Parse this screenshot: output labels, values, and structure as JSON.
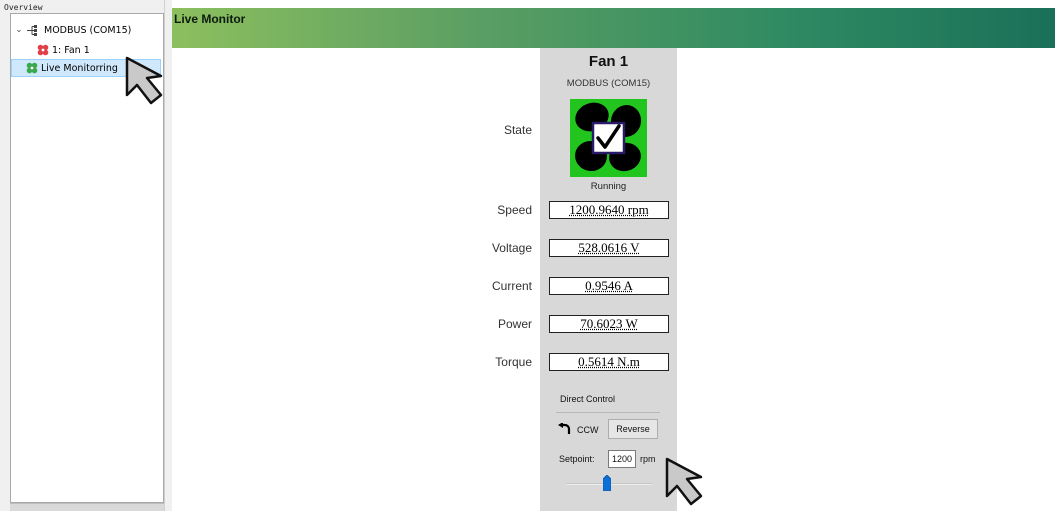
{
  "overview": {
    "header": "Overview",
    "tree": [
      {
        "label": "MODBUS (COM15)",
        "icon": "network-icon",
        "expanded": true
      },
      {
        "label": "1: Fan 1",
        "icon": "fan-icon",
        "color": "#e04048"
      },
      {
        "label": "Live Monitorring",
        "icon": "fan-icon",
        "color": "#3aa84c",
        "selected": true
      }
    ]
  },
  "monitor": {
    "title": "Live Monitor",
    "device_name": "Fan 1",
    "device_bus": "MODBUS (COM15)",
    "state_label": "State",
    "state_value": "Running",
    "state_icon": "fan-running-check-icon",
    "state_color": "#22c41e",
    "rows": [
      {
        "label": "Speed",
        "value": "1200.9640 rpm"
      },
      {
        "label": "Voltage",
        "value": "528.0616 V"
      },
      {
        "label": "Current",
        "value": "0.9546 A"
      },
      {
        "label": "Power",
        "value": "70.6023 W"
      },
      {
        "label": "Torque",
        "value": "0.5614 N.m"
      }
    ]
  },
  "direct_control": {
    "label": "Direct Control",
    "direction_text": "CCW",
    "direction_icon": "rotate-ccw-icon",
    "reverse_label": "Reverse",
    "setpoint_label": "Setpoint:",
    "setpoint_value": "1200",
    "setpoint_unit": "rpm"
  },
  "banner_colors": [
    "#8cbf5e",
    "#1a7058"
  ]
}
